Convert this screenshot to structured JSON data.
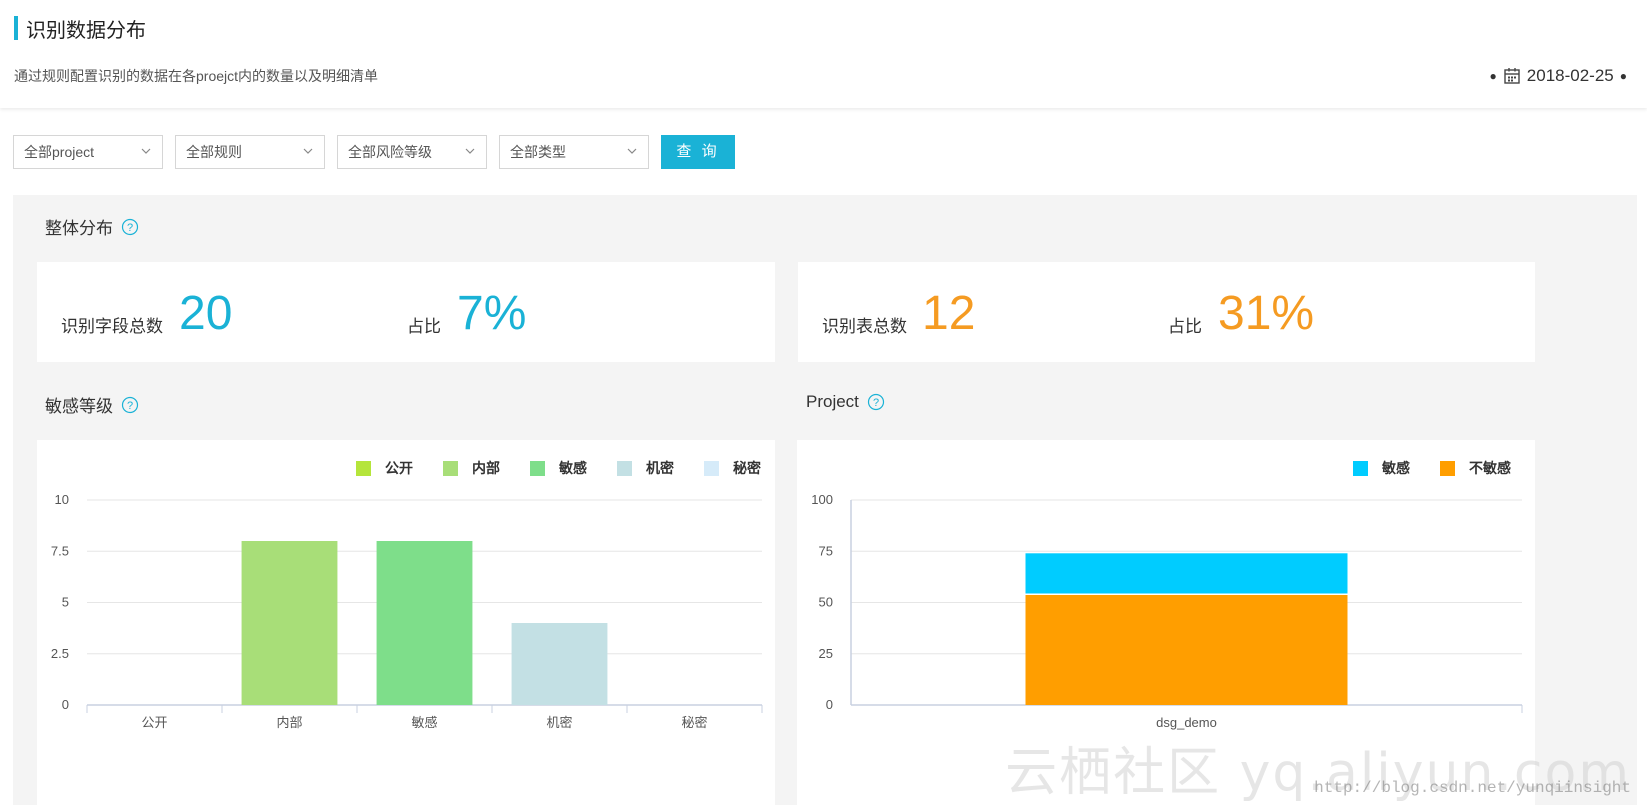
{
  "header": {
    "title": "识别数据分布",
    "subtitle": "通过规则配置识别的数据在各proejct内的数量以及明细清单",
    "date": "2018-02-25"
  },
  "filters": [
    {
      "label": "全部project"
    },
    {
      "label": "全部规则"
    },
    {
      "label": "全部风险等级"
    },
    {
      "label": "全部类型"
    }
  ],
  "query_label": "查 询",
  "overall": {
    "title": "整体分布",
    "fields_label": "识别字段总数",
    "fields_value": "20",
    "fields_ratio_label": "占比",
    "fields_ratio_value": "7%",
    "tables_label": "识别表总数",
    "tables_value": "12",
    "tables_ratio_label": "占比",
    "tables_ratio_value": "31%"
  },
  "sensitivity": {
    "title": "敏感等级"
  },
  "project": {
    "title": "Project"
  },
  "colors": {
    "accent": "#1ab2d6",
    "orange": "#f59b22",
    "public": "#b5e53b",
    "internal": "#a8de78",
    "sensitive": "#7ede8a",
    "confidential": "#c3e0e4",
    "secret": "#d6ebf9",
    "project_sensitive": "#00ccff",
    "project_insensitive": "#ff9e00"
  },
  "chart_data": [
    {
      "type": "bar",
      "categories": [
        "公开",
        "内部",
        "敏感",
        "机密",
        "秘密"
      ],
      "values": [
        0,
        8,
        8,
        4,
        0
      ],
      "series_colors": [
        "#b5e53b",
        "#a8de78",
        "#7ede8a",
        "#c3e0e4",
        "#d6ebf9"
      ],
      "legend": [
        "公开",
        "内部",
        "敏感",
        "机密",
        "秘密"
      ],
      "legend_position": "top-right",
      "yticks": [
        "0",
        "2.5",
        "5",
        "7.5",
        "10"
      ],
      "ylim": [
        0,
        10
      ],
      "grid": true
    },
    {
      "type": "bar",
      "stacked": true,
      "categories": [
        "dsg_demo"
      ],
      "series": [
        {
          "name": "不敏感",
          "values": [
            54
          ],
          "color": "#ff9e00"
        },
        {
          "name": "敏感",
          "values": [
            20
          ],
          "color": "#00ccff"
        }
      ],
      "legend": [
        "敏感",
        "不敏感"
      ],
      "legend_position": "top-right",
      "yticks": [
        "0",
        "25",
        "50",
        "75",
        "100"
      ],
      "ylim": [
        0,
        100
      ],
      "grid": true
    }
  ],
  "watermark": {
    "text": "云栖社区 yq.aliyun.com",
    "url": "http://blog.csdn.net/yunqiinsight"
  }
}
